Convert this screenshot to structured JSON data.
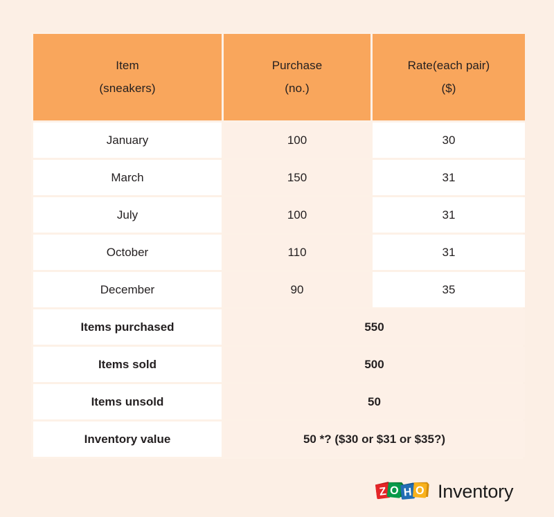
{
  "table": {
    "headers": [
      {
        "line1": "Item",
        "line2": "(sneakers)"
      },
      {
        "line1": "Purchase",
        "line2": "(no.)"
      },
      {
        "line1": "Rate(each pair)",
        "line2": "($)"
      }
    ],
    "rows": [
      {
        "item": "January",
        "purchase": "100",
        "rate": "30"
      },
      {
        "item": "March",
        "purchase": "150",
        "rate": "31"
      },
      {
        "item": "July",
        "purchase": "100",
        "rate": "31"
      },
      {
        "item": "October",
        "purchase": "110",
        "rate": "31"
      },
      {
        "item": "December",
        "purchase": "90",
        "rate": "35"
      }
    ],
    "summary": [
      {
        "label": "Items purchased",
        "value": "550"
      },
      {
        "label": "Items sold",
        "value": "500"
      },
      {
        "label": "Items unsold",
        "value": "50"
      },
      {
        "label": "Inventory value",
        "value": "50 *? ($30 or $31 or $35?)"
      }
    ]
  },
  "logo": {
    "brand": "ZOHO",
    "product": "Inventory",
    "letters": [
      {
        "char": "Z",
        "color": "#e42527"
      },
      {
        "char": "O",
        "color": "#089949"
      },
      {
        "char": "H",
        "color": "#226db4"
      },
      {
        "char": "O",
        "color": "#f9b21d"
      }
    ]
  },
  "colors": {
    "page_background": "#fcefe5",
    "header_orange": "#f9a65c",
    "cell_white": "#ffffff",
    "cell_peach": "#fdf0e7",
    "grid_line": "#fdf1e7",
    "text": "#231f20"
  }
}
